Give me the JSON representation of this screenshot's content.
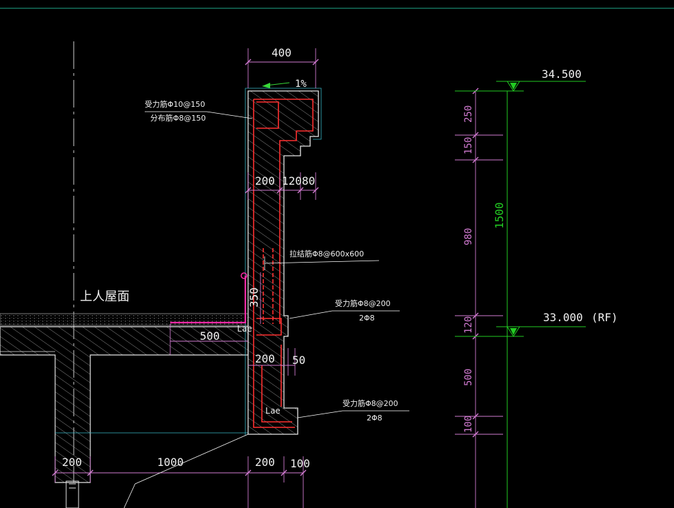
{
  "colors": {
    "background": "#000000",
    "frame_line": "#1faa8a",
    "concrete_outline": "#e6e6e6",
    "hatch": "#bfbfbf",
    "rebar": "#ff3030",
    "dimension": "#d27bd2",
    "dimension_text": "#f0f0f0",
    "level_line": "#22cc22",
    "waterproof": "#ff2aa8",
    "cyan": "#38b8c8",
    "leader": "#ffffff",
    "blue_grid": "#5a78c8"
  },
  "labels": {
    "roof_name": "上人屋面",
    "slope": "1%",
    "top_rebar_main": "受力筋Φ10@150",
    "top_rebar_dist": "分布筋Φ8@150",
    "tie_bar": "拉结筋Φ8@600x600",
    "mid_rebar_main": "受力筋Φ8@200",
    "mid_rebar_count": "2Φ8",
    "bottom_rebar_main": "受力筋Φ8@200",
    "bottom_rebar_count": "2Φ8",
    "lae_upper": "Lae",
    "lae_lower": "Lae"
  },
  "dimensions": {
    "parapet_width": "400",
    "wall_200": "200",
    "step_120": "120",
    "step_80": "80",
    "height_350": "350",
    "slab_500": "500",
    "beam_200": "200",
    "beam_50": "50",
    "bottom_200_left": "200",
    "bottom_1000": "1000",
    "bottom_200_right": "200",
    "bottom_100": "100"
  },
  "elevations": {
    "top_level": "34.500",
    "roof_level": "33.000",
    "roof_tag": "(RF)",
    "seg_250": "250",
    "seg_150": "150",
    "seg_980": "980",
    "seg_120": "120",
    "seg_500": "500",
    "seg_100": "100",
    "total_1500": "1500"
  }
}
